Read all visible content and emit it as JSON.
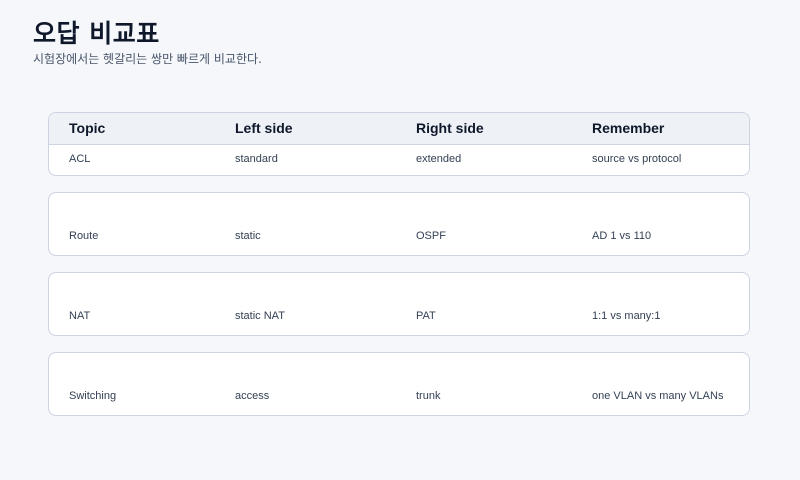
{
  "page": {
    "title": "오답 비교표",
    "subtitle": "시험장에서는 헷갈리는 쌍만 빠르게 비교한다."
  },
  "table": {
    "headers": [
      "Topic",
      "Left side",
      "Right side",
      "Remember"
    ],
    "rows": [
      [
        "ACL",
        "standard",
        "extended",
        "source vs protocol"
      ],
      [
        "Route",
        "static",
        "OSPF",
        "AD 1 vs 110"
      ],
      [
        "NAT",
        "static NAT",
        "PAT",
        "1:1 vs many:1"
      ],
      [
        "Switching",
        "access",
        "trunk",
        "one VLAN vs many VLANs"
      ]
    ]
  }
}
